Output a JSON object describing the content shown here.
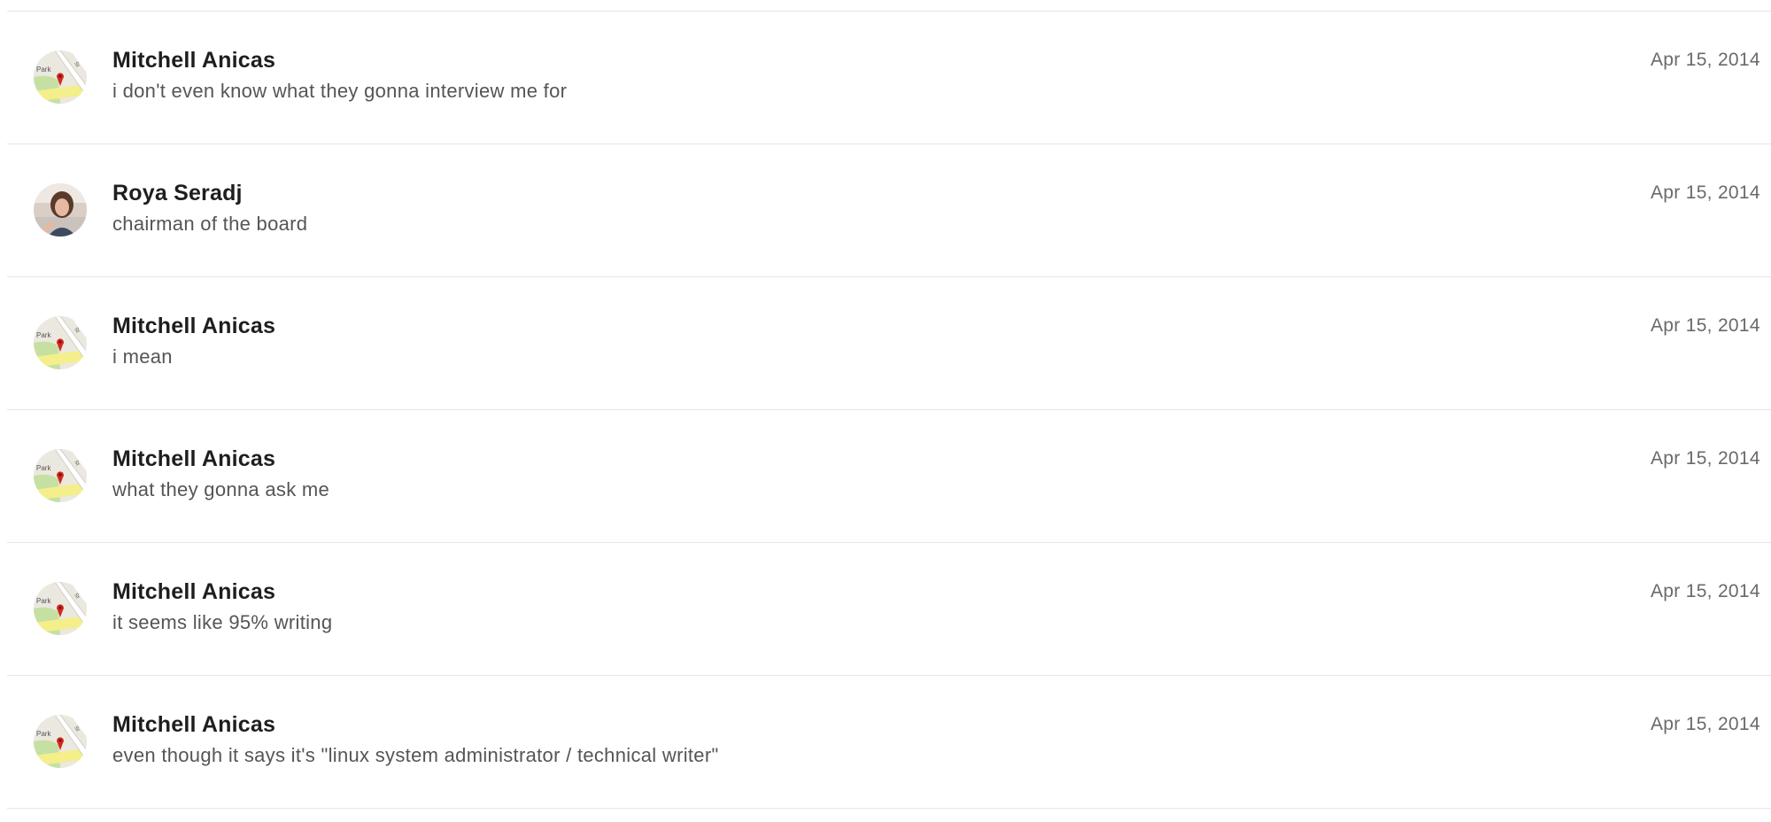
{
  "messages": [
    {
      "sender": "Mitchell Anicas",
      "text": "i don't even know what they gonna interview me for",
      "date": "Apr 15, 2014",
      "avatar": "map-avatar"
    },
    {
      "sender": "Roya Seradj",
      "text": "chairman of the board",
      "date": "Apr 15, 2014",
      "avatar": "photo-avatar"
    },
    {
      "sender": "Mitchell Anicas",
      "text": "i mean",
      "date": "Apr 15, 2014",
      "avatar": "map-avatar"
    },
    {
      "sender": "Mitchell Anicas",
      "text": "what they gonna ask me",
      "date": "Apr 15, 2014",
      "avatar": "map-avatar"
    },
    {
      "sender": "Mitchell Anicas",
      "text": "it seems like 95% writing",
      "date": "Apr 15, 2014",
      "avatar": "map-avatar"
    },
    {
      "sender": "Mitchell Anicas",
      "text": "even though it says it's \"linux system administrator / technical writer\"",
      "date": "Apr 15, 2014",
      "avatar": "map-avatar"
    }
  ],
  "map_avatar": {
    "label": "Park"
  }
}
